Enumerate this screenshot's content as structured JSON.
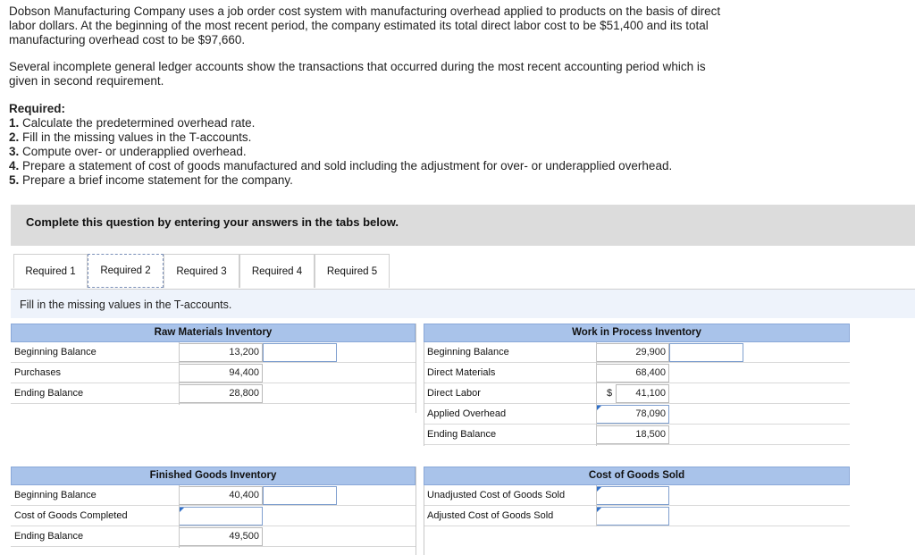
{
  "intro": {
    "p1_l1": "Dobson Manufacturing Company uses a job order cost system with manufacturing overhead applied to products on the basis of direct",
    "p1_l2": "labor dollars. At the beginning of the most recent period, the company estimated its total direct labor cost to be $51,400 and its total",
    "p1_l3": "manufacturing overhead cost to be $97,660.",
    "p2_l1": "Several incomplete general ledger accounts show the transactions that occurred during the most recent accounting period which is",
    "p2_l2": "given in second requirement."
  },
  "required": {
    "heading": "Required:",
    "items": [
      {
        "num": "1.",
        "text": " Calculate the predetermined overhead rate."
      },
      {
        "num": "2.",
        "text": " Fill in the missing values in the T-accounts."
      },
      {
        "num": "3.",
        "text": " Compute over- or underapplied overhead."
      },
      {
        "num": "4.",
        "text": " Prepare a statement of cost of goods manufactured and sold including the adjustment for over- or underapplied overhead."
      },
      {
        "num": "5.",
        "text": " Prepare a brief income statement for the company."
      }
    ]
  },
  "banner": "Complete this question by entering your answers in the tabs below.",
  "tabs": [
    "Required 1",
    "Required 2",
    "Required 3",
    "Required 4",
    "Required 5"
  ],
  "active_tab": "Required 2",
  "instruction": "Fill in the missing values in the T-accounts.",
  "raw_materials": {
    "title": "Raw Materials Inventory",
    "rows": [
      {
        "label": "Beginning Balance",
        "value": "13,200"
      },
      {
        "label": "Purchases",
        "value": "94,400"
      },
      {
        "label": "Ending Balance",
        "value": "28,800"
      }
    ]
  },
  "wip": {
    "title": "Work in Process Inventory",
    "rows": [
      {
        "label": "Beginning Balance",
        "value": "29,900"
      },
      {
        "label": "Direct Materials",
        "value": "68,400"
      },
      {
        "label": "Direct Labor",
        "value": "41,100",
        "prefix": "$"
      },
      {
        "label": "Applied Overhead",
        "value": "78,090"
      },
      {
        "label": "Ending Balance",
        "value": "18,500"
      }
    ]
  },
  "finished_goods": {
    "title": "Finished Goods Inventory",
    "rows": [
      {
        "label": "Beginning Balance",
        "value": "40,400"
      },
      {
        "label": "Cost of Goods Completed",
        "value": ""
      },
      {
        "label": "Ending Balance",
        "value": "49,500"
      }
    ]
  },
  "cogs": {
    "title": "Cost of Goods Sold",
    "rows": [
      {
        "label": "Unadjusted Cost of Goods Sold",
        "value": ""
      },
      {
        "label": "Adjusted Cost of Goods Sold",
        "value": ""
      }
    ]
  }
}
